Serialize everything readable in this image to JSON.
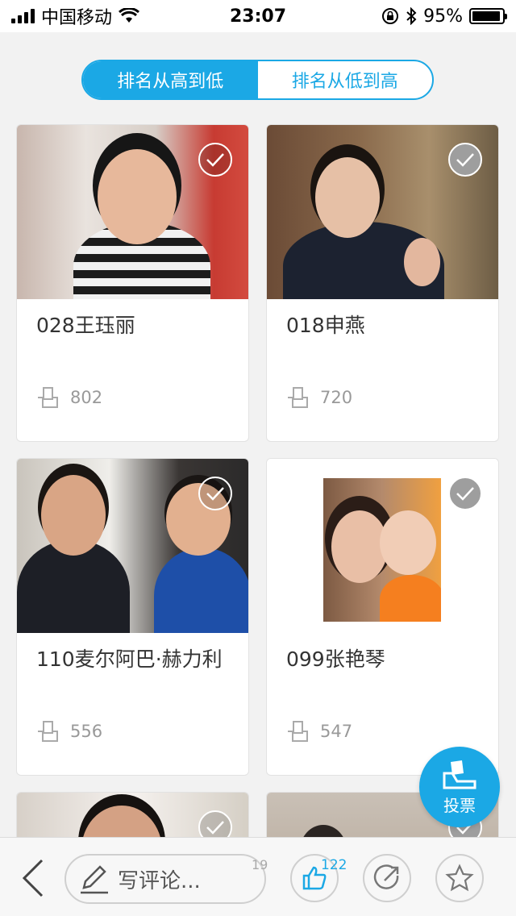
{
  "status_bar": {
    "carrier": "中国移动",
    "time": "23:07",
    "battery_percent": "95%",
    "battery_level": 0.95
  },
  "sort_toggle": {
    "options": [
      {
        "label": "排名从高到低",
        "active": true
      },
      {
        "label": "排名从低到高",
        "active": false
      }
    ]
  },
  "candidates": [
    {
      "name": "028王珏丽",
      "votes": "802",
      "selected": false
    },
    {
      "name": "018申燕",
      "votes": "720",
      "selected": true
    },
    {
      "name": "110麦尔阿巴·赫力利",
      "votes": "556",
      "selected": false
    },
    {
      "name": "099张艳琴",
      "votes": "547",
      "selected": true
    }
  ],
  "vote_button": {
    "label": "投票",
    "icon": "ballot-box-icon"
  },
  "bottom_bar": {
    "comment_placeholder": "写评论...",
    "comment_count": "19",
    "like_count": "122"
  },
  "colors": {
    "accent": "#1ba8e5",
    "text": "#333333",
    "muted": "#999999"
  }
}
